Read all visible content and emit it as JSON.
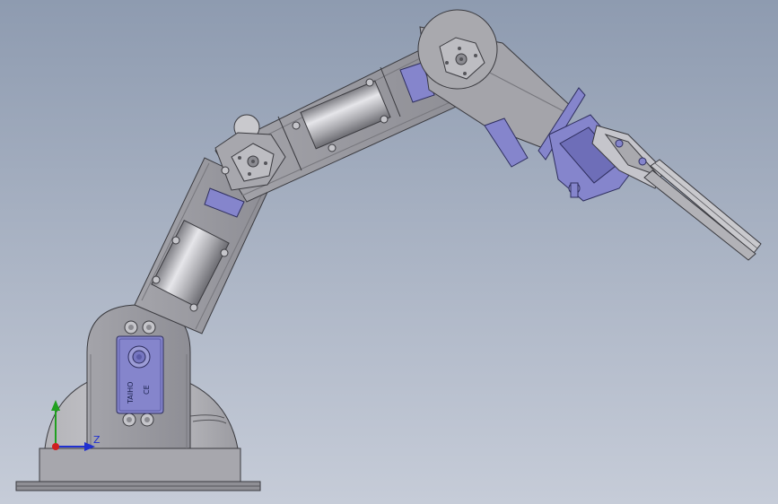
{
  "viewport": {
    "background_top": "#8e9bb0",
    "background_bottom": "#c6ccd8"
  },
  "colors": {
    "part_gray": "#9a9aa0",
    "part_light": "#c9c9cd",
    "part_dark": "#6f6f75",
    "servo_blue": "#8585cc",
    "servo_dark": "#5b5ba6",
    "axis_x": "#d02020",
    "axis_y": "#20a020",
    "axis_z": "#2030d0"
  },
  "triad": {
    "z_label": "Z"
  },
  "servo": {
    "base_text_1": "TAIHO",
    "base_text_2": "CE"
  }
}
